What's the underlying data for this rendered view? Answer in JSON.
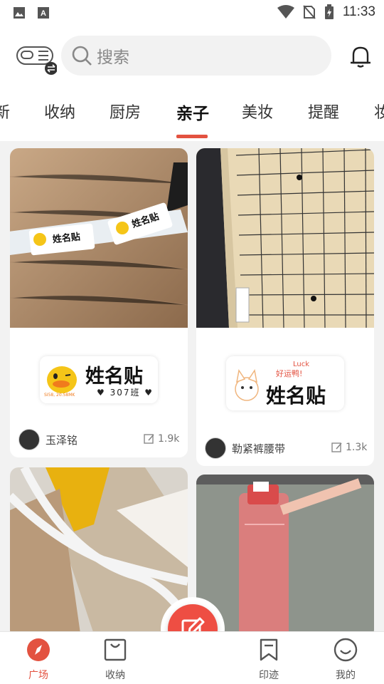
{
  "status_bar": {
    "time": "11:33"
  },
  "search": {
    "placeholder": "搜索"
  },
  "tabs": [
    {
      "label": "新"
    },
    {
      "label": "收纳"
    },
    {
      "label": "厨房"
    },
    {
      "label": "亲子",
      "active": true
    },
    {
      "label": "美妆"
    },
    {
      "label": "提醒"
    },
    {
      "label": "妆"
    }
  ],
  "cards": [
    {
      "label_title": "姓名贴",
      "label_sub": "♥ 307班 ♥",
      "label_tiny": "SI58, 20.58MK",
      "author": "玉泽铭",
      "edits": "1.9k"
    },
    {
      "label_title": "姓名贴",
      "label_sub": "好运鸭!",
      "label_tiny": "Luck",
      "author": "勒紧裤腰带",
      "edits": "1.3k"
    },
    {},
    {}
  ],
  "bottom_nav": [
    {
      "label": "广场",
      "icon": "compass-icon",
      "active": true
    },
    {
      "label": "收纳",
      "icon": "bag-icon"
    },
    {
      "label": "印迹",
      "icon": "bookmark-icon"
    },
    {
      "label": "我的",
      "icon": "smile-icon"
    }
  ],
  "colors": {
    "accent": "#e35240",
    "fab": "#ee4e43",
    "background": "#f2f2f2"
  }
}
